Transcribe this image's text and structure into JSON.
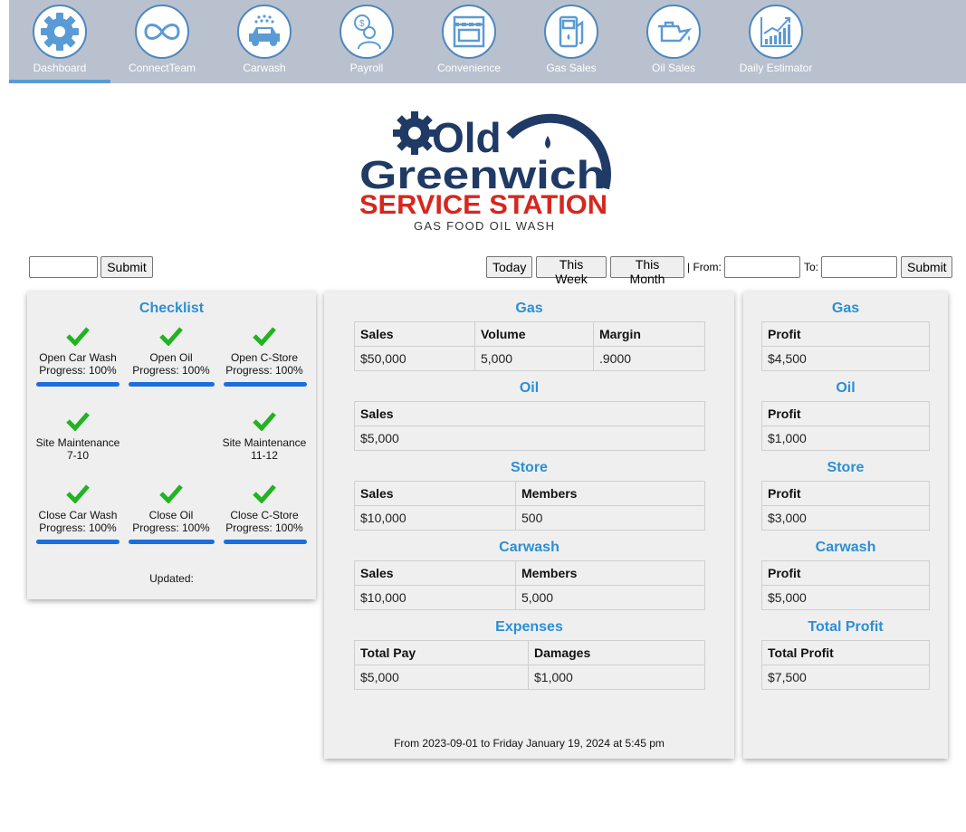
{
  "nav": {
    "items": [
      {
        "label": "Dashboard",
        "icon": "gear-icon"
      },
      {
        "label": "ConnectTeam",
        "icon": "infinity-icon"
      },
      {
        "label": "Carwash",
        "icon": "carwash-icon"
      },
      {
        "label": "Payroll",
        "icon": "payroll-icon"
      },
      {
        "label": "Convenience",
        "icon": "store-icon"
      },
      {
        "label": "Gas Sales",
        "icon": "fuel-pump-icon"
      },
      {
        "label": "Oil Sales",
        "icon": "oil-can-icon"
      },
      {
        "label": "Daily Estimator",
        "icon": "growth-chart-icon"
      }
    ],
    "active": "Dashboard"
  },
  "logo": {
    "line1": "Old",
    "line2": "Greenwich",
    "line3": "SERVICE STATION",
    "tagline": "GAS FOOD OIL WASH"
  },
  "filters": {
    "left_input_value": "",
    "submit_label": "Submit",
    "today_label": "Today",
    "week_label": "This Week",
    "month_label": "This Month",
    "from_label": "| From:",
    "from_value": "",
    "to_label": "To:",
    "to_value": "",
    "submit2_label": "Submit"
  },
  "checklist": {
    "title": "Checklist",
    "items": [
      {
        "line1": "Open Car Wash",
        "line2": "Progress: 100%",
        "progress": 100
      },
      {
        "line1": "Open Oil",
        "line2": "Progress: 100%",
        "progress": 100
      },
      {
        "line1": "Open C-Store",
        "line2": "Progress: 100%",
        "progress": 100
      },
      {
        "line1": "Site Maintenance",
        "line2": "7-10"
      },
      {
        "line1": "Site Maintenance",
        "line2": "11-12"
      },
      {
        "line1": "Close Car Wash",
        "line2": "Progress: 100%",
        "progress": 100
      },
      {
        "line1": "Close Oil",
        "line2": "Progress: 100%",
        "progress": 100
      },
      {
        "line1": "Close C-Store",
        "line2": "Progress: 100%",
        "progress": 100
      }
    ],
    "updated_label": "Updated:"
  },
  "sales": {
    "gas": {
      "title": "Gas",
      "headers": [
        "Sales",
        "Volume",
        "Margin"
      ],
      "values": [
        "$50,000",
        "5,000",
        ".9000"
      ]
    },
    "oil": {
      "title": "Oil",
      "headers": [
        "Sales"
      ],
      "values": [
        "$5,000"
      ]
    },
    "store": {
      "title": "Store",
      "headers": [
        "Sales",
        "Members"
      ],
      "values": [
        "$10,000",
        "500"
      ]
    },
    "carwash": {
      "title": "Carwash",
      "headers": [
        "Sales",
        "Members"
      ],
      "values": [
        "$10,000",
        "5,000"
      ]
    },
    "expenses": {
      "title": "Expenses",
      "headers": [
        "Total Pay",
        "Damages"
      ],
      "values": [
        "$5,000",
        "$1,000"
      ]
    },
    "range_text": "From 2023-09-01 to Friday January 19, 2024 at 5:45 pm"
  },
  "profit": {
    "gas": {
      "title": "Gas",
      "header": "Profit",
      "value": "$4,500"
    },
    "oil": {
      "title": "Oil",
      "header": "Profit",
      "value": "$1,000"
    },
    "store": {
      "title": "Store",
      "header": "Profit",
      "value": "$3,000"
    },
    "carwash": {
      "title": "Carwash",
      "header": "Profit",
      "value": "$5,000"
    },
    "total": {
      "title": "Total Profit",
      "header": "Total Profit",
      "value": "$7,500"
    }
  },
  "colors": {
    "nav_bg": "#b9c1cf",
    "accent": "#2b8fd3",
    "check": "#22b322",
    "progress": "#1a6fdc",
    "logo_navy": "#1f3a64",
    "logo_red": "#d6271f"
  }
}
